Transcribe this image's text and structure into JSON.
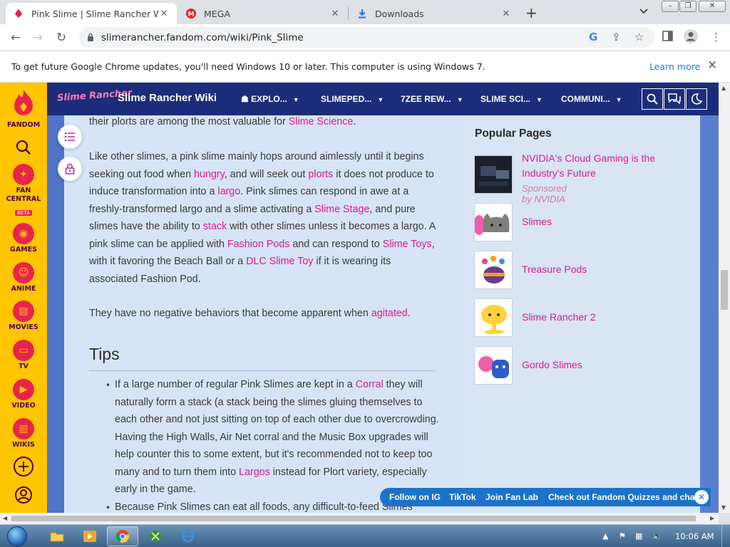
{
  "browser": {
    "tabs": [
      {
        "title": "Pink Slime | Slime Rancher Wiki |",
        "icon": "fandom-icon",
        "active": true
      },
      {
        "title": "MEGA",
        "icon": "mega-icon",
        "active": false
      },
      {
        "title": "Downloads",
        "icon": "download-icon",
        "active": false
      }
    ],
    "new_tab": "+",
    "tab_search": "⌄",
    "url": "slimerancher.fandom.com/wiki/Pink_Slime",
    "infobar": {
      "message": "To get future Google Chrome updates, you'll need Windows 10 or later. This computer is using Windows 7.",
      "link": "Learn more",
      "close": "✕"
    }
  },
  "fandom_rail": {
    "items": [
      {
        "label": "FANDOM",
        "icon": "fandom-flame-icon"
      },
      {
        "label": "",
        "icon": "search-icon"
      },
      {
        "label": "FAN CENTRAL",
        "badge": "BETA",
        "icon": "rocket-icon"
      },
      {
        "label": "GAMES",
        "icon": "gamepad-icon"
      },
      {
        "label": "ANIME",
        "icon": "anime-icon"
      },
      {
        "label": "MOVIES",
        "icon": "movies-icon"
      },
      {
        "label": "TV",
        "icon": "tv-icon"
      },
      {
        "label": "VIDEO",
        "icon": "video-icon"
      },
      {
        "label": "WIKIS",
        "icon": "wikis-icon"
      },
      {
        "label": "",
        "icon": "add-icon"
      },
      {
        "label": "",
        "icon": "user-icon"
      }
    ]
  },
  "community_header": {
    "logo_text": "Slime Rancher",
    "wiki_name": "Slime Rancher Wiki",
    "nav": [
      {
        "label": "EXPLO...",
        "icon": "explore-icon"
      },
      {
        "label": "SLIMEPED..."
      },
      {
        "label": "7ZEE REW..."
      },
      {
        "label": "SLIME SCI..."
      },
      {
        "label": "COMMUNI..."
      }
    ],
    "buttons": [
      "search-icon",
      "discussions-icon",
      "theme-toggle-icon"
    ]
  },
  "article": {
    "p1": {
      "t1": "their plorts are among the most valuable for ",
      "l1": "Slime Science",
      "t2": "."
    },
    "p2": {
      "t1": "Like other slimes, a pink slime mainly hops around aimlessly until it begins seeking out food when ",
      "l1": "hungry",
      "t2": ", and will seek out ",
      "l2": "plorts",
      "t3": " it does not produce to induce transformation into a ",
      "l3": "largo",
      "t4": ". Pink slimes can respond in awe at a freshly-transformed largo and a slime activating a ",
      "l4": "Slime Stage",
      "t5": ", and pure slimes have the ability to ",
      "l5": "stack",
      "t6": " with other slimes unless it becomes a largo. A pink slime can be applied with ",
      "l6": "Fashion Pods",
      "t7": " and can respond to ",
      "l7": "Slime Toys",
      "t8": ", with it favoring the Beach Ball or a ",
      "l8": "DLC Slime Toy",
      "t9": " if it is wearing its associated Fashion Pod."
    },
    "p3": {
      "t1": "They have no negative behaviors that become apparent when ",
      "l1": "agitated",
      "t2": "."
    },
    "tips_heading": "Tips",
    "tip1": {
      "t1": "If a large number of regular Pink Slimes are kept in a ",
      "l1": "Corral",
      "t2": " they will naturally form a stack (a stack being the slimes gluing themselves to each other and not just sitting on top of each other due to overcrowding. Having the High Walls, Air Net corral and the Music Box upgrades will help counter this to some extent, but it's recommended not to keep too many and to turn them into ",
      "l2": "Largos",
      "t3": " instead for Plort variety, especially early in the game."
    },
    "tip2": {
      "t1": "Because Pink Slimes can eat all foods, any difficult-to-feed Slimes"
    }
  },
  "popular_pages": {
    "title": "Popular Pages",
    "items": [
      {
        "label": "NVIDIA's Cloud Gaming is the Industry's Future",
        "sponsor": "Sponsored by NVIDIA"
      },
      {
        "label": "Slimes"
      },
      {
        "label": "Treasure Pods"
      },
      {
        "label": "Slime Rancher 2"
      },
      {
        "label": "Gordo Slimes"
      }
    ]
  },
  "promo_bar": {
    "items": [
      "Follow on IG",
      "TikTok",
      "Join Fan Lab",
      "Check out Fandom Quizzes and cha"
    ],
    "close": "✕"
  },
  "taskbar": {
    "clock": "10:06 AM",
    "apps": [
      "explorer-icon",
      "media-player-icon",
      "chrome-icon",
      "xbox-icon",
      "ie-icon"
    ]
  },
  "colors": {
    "link": "#d61d8c",
    "fandom_rail": "#ffc500",
    "header": "#1b2d7a",
    "article_bg": "#d7e4f7",
    "promo": "#1a73c8"
  }
}
